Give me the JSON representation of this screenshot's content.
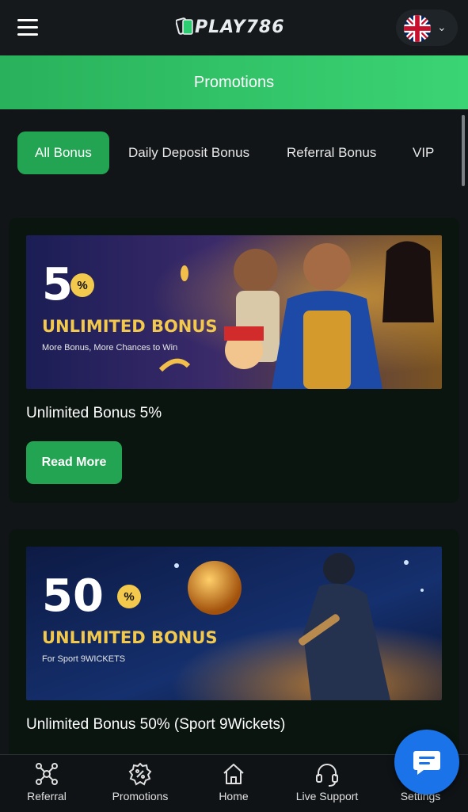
{
  "header": {
    "logo_text": "PLAY786",
    "language_flag": "uk-flag-icon"
  },
  "page": {
    "title": "Promotions"
  },
  "tabs": [
    {
      "label": "All Bonus",
      "active": true
    },
    {
      "label": "Daily Deposit Bonus",
      "active": false
    },
    {
      "label": "Referral Bonus",
      "active": false
    },
    {
      "label": "VIP",
      "active": false
    }
  ],
  "promotions": [
    {
      "title": "Unlimited Bonus 5%",
      "button": "Read More",
      "banner": {
        "percent": "5",
        "percent_sign": "%",
        "headline": "UNLIMITED BONUS",
        "subline": "More Bonus, More Chances to Win"
      }
    },
    {
      "title": "Unlimited Bonus 50% (Sport 9Wickets)",
      "banner": {
        "percent": "50",
        "percent_sign": "%",
        "headline": "UNLIMITED BONUS",
        "subline": "For Sport 9WICKETS"
      }
    }
  ],
  "bottom_nav": [
    {
      "label": "Referral",
      "icon": "referral-network-icon"
    },
    {
      "label": "Promotions",
      "icon": "promotions-percent-icon"
    },
    {
      "label": "Home",
      "icon": "home-icon"
    },
    {
      "label": "Live Support",
      "icon": "headset-icon"
    },
    {
      "label": "Settings",
      "icon": "gear-icon"
    }
  ],
  "colors": {
    "brand_green": "#23a452",
    "header_green": "#3bd474",
    "background": "#111518",
    "card": "#0a1510",
    "chat_blue": "#1a73e8"
  }
}
